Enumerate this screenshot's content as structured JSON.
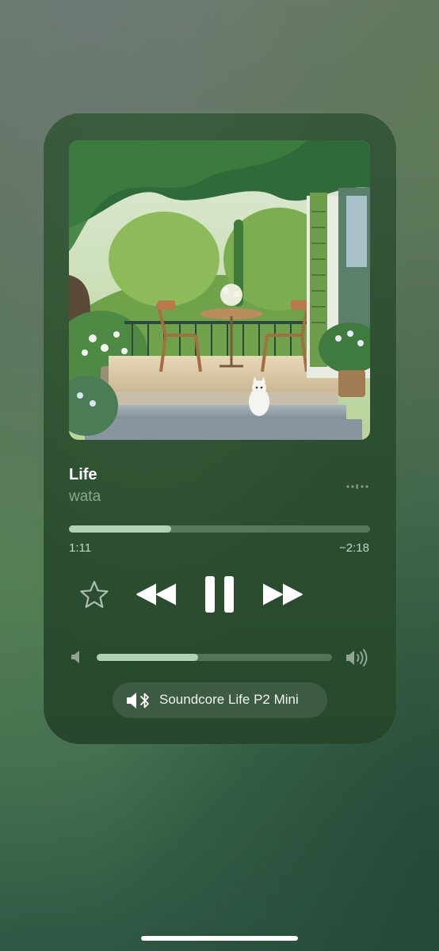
{
  "now_playing": {
    "title": "Life",
    "artist": "wata",
    "elapsed": "1:11",
    "remaining": "−2:18",
    "progress_fraction": 0.34
  },
  "volume": {
    "level_fraction": 0.43
  },
  "output_device": {
    "name": "Soundcore Life P2 Mini",
    "icon": "bluetooth-speaker-icon"
  },
  "icons": {
    "favorite": "star-outline-icon",
    "previous": "rewind-icon",
    "play_pause": "pause-icon",
    "next": "fast-forward-icon",
    "more": "more-dots-icon",
    "volume_low": "speaker-low-icon",
    "volume_high": "speaker-high-icon"
  },
  "colors": {
    "card": "#2d5030",
    "accent_fill": "#cdebcd",
    "text_primary": "#ffffff"
  }
}
